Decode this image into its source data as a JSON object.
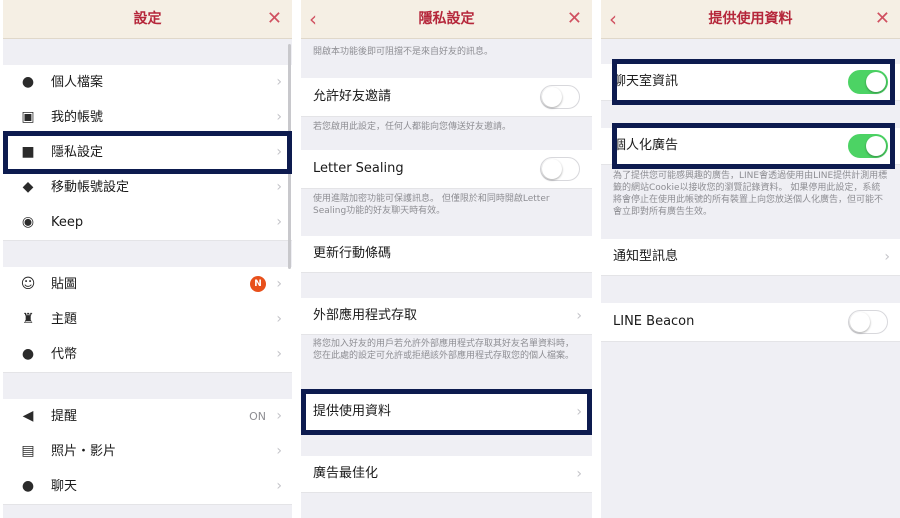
{
  "panel1": {
    "title": "設定",
    "close_icon": "close-icon",
    "items": [
      {
        "label": "個人檔案",
        "icon": "person-icon"
      },
      {
        "label": "我的帳號",
        "icon": "id-card-icon"
      },
      {
        "label": "隱私設定",
        "icon": "lock-icon"
      },
      {
        "label": "移動帳號設定",
        "icon": "shield-icon"
      },
      {
        "label": "Keep",
        "icon": "keep-icon"
      },
      {
        "label": "貼圖",
        "icon": "smiley-icon",
        "badge": "N"
      },
      {
        "label": "主題",
        "icon": "brush-icon"
      },
      {
        "label": "代幣",
        "icon": "coin-icon"
      },
      {
        "label": "提醒",
        "icon": "speaker-icon",
        "value": "ON"
      },
      {
        "label": "照片・影片",
        "icon": "photo-icon"
      },
      {
        "label": "聊天",
        "icon": "chat-icon"
      }
    ]
  },
  "panel2": {
    "title": "隱私設定",
    "top_note": "開啟本功能後即可阻擋不是來自好友的訊息。",
    "items": [
      {
        "label": "允許好友邀請",
        "note": "若您啟用此設定，任何人都能向您傳送好友邀請。"
      },
      {
        "label": "Letter Sealing",
        "note": "使用進階加密功能可保護訊息。 但僅限於和同時開啟Letter Sealing功能的好友聊天時有效。"
      },
      {
        "label": "更新行動條碼"
      },
      {
        "label": "外部應用程式存取",
        "note": "將您加入好友的用戶若允許外部應用程式存取其好友名單資料時，您在此處的設定可允許或拒絕該外部應用程式存取您的個人檔案。"
      },
      {
        "label": "提供使用資料"
      },
      {
        "label": "廣告最佳化"
      }
    ]
  },
  "panel3": {
    "title": "提供使用資料",
    "items": [
      {
        "label": "聊天室資訊",
        "toggle": "on"
      },
      {
        "label": "個人化廣告",
        "toggle": "on",
        "note": "為了提供您可能感興趣的廣告，LINE會透過使用由LINE提供計測用標籤的網站Cookie以接收您的瀏覽記錄資料。 如果停用此設定，系統將會停止在使用此帳號的所有裝置上向您放送個人化廣告，但可能不會立即對所有廣告生效。"
      },
      {
        "label": "通知型訊息"
      },
      {
        "label": "LINE Beacon",
        "toggle": "off"
      }
    ]
  },
  "colors": {
    "header_title": "#b5263a",
    "toggle_on": "#4cd364",
    "highlight": "#0d1b4f",
    "badge": "#e8501b"
  }
}
